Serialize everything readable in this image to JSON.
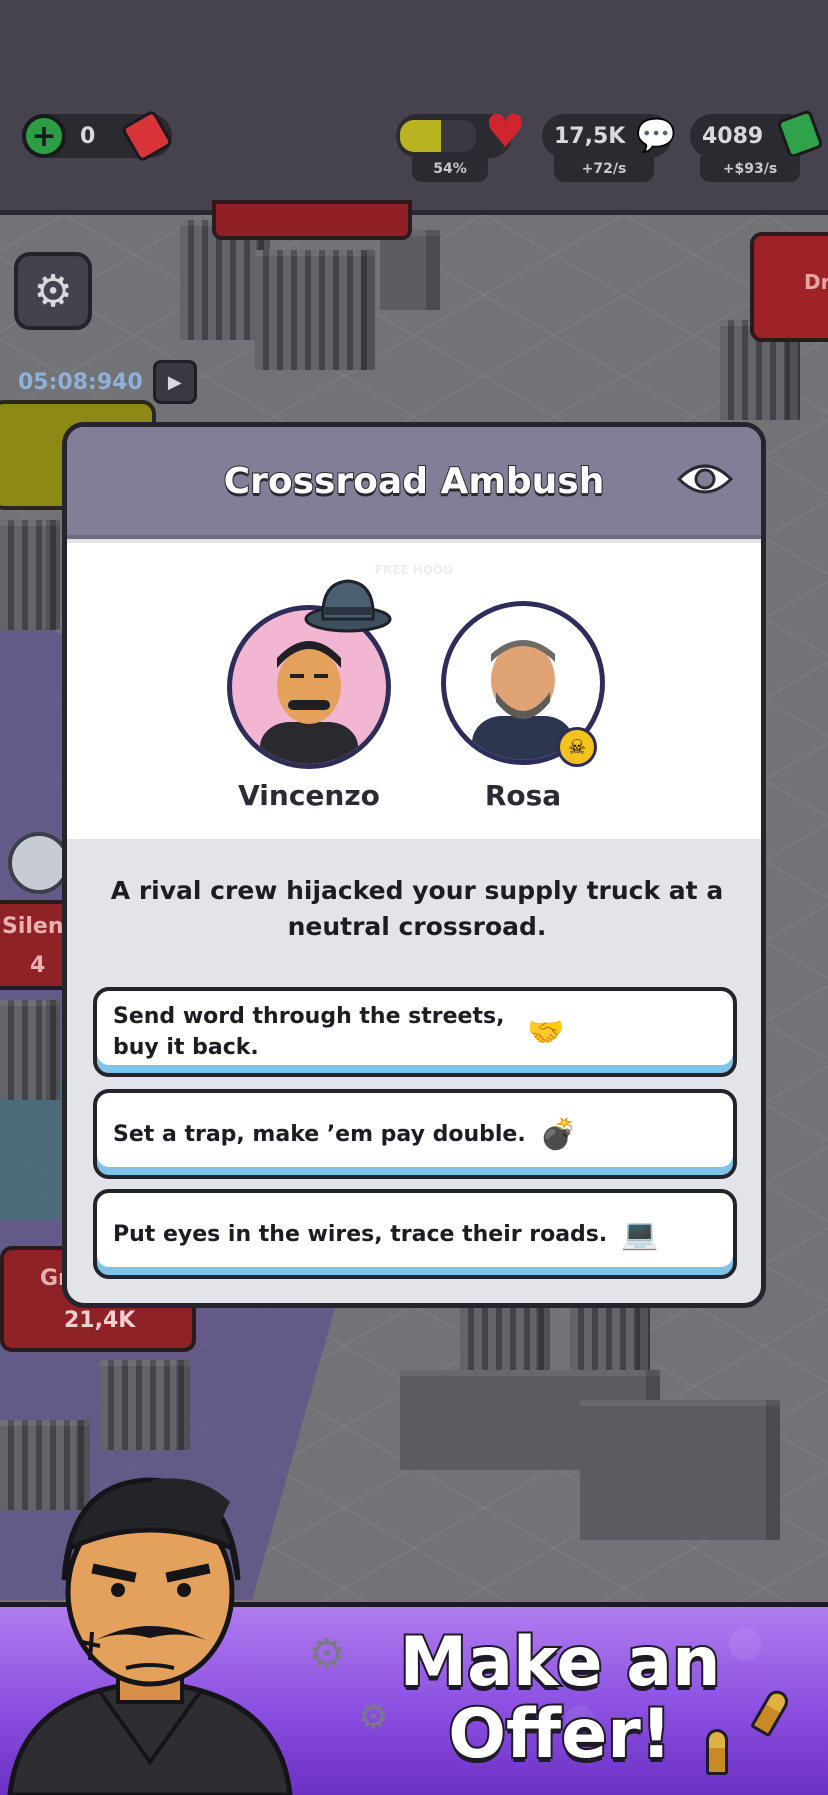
{
  "hud": {
    "gems_value": "0",
    "health_percent": 54,
    "health_label": "54%",
    "influence_value": "17,5K",
    "influence_rate": "+72/s",
    "cash_value": "4089",
    "cash_rate": "+$93/s"
  },
  "map": {
    "timer": "05:08:940",
    "right_label": "Dr",
    "silence_label": "Silenc",
    "silence_count": "4",
    "gr_label": "Gr",
    "gr_count": "21,4K"
  },
  "modal": {
    "title": "Crossroad Ambush",
    "faint_label": "FREE HOOD",
    "characters": [
      {
        "name": "Vincenzo"
      },
      {
        "name": "Rosa"
      }
    ],
    "story": "A rival crew hijacked your supply truck at a neutral crossroad.",
    "choices": [
      {
        "label": "Send word through the streets, buy it back.",
        "icon": "handshake-icon"
      },
      {
        "label": "Set a trap, make ’em pay double.",
        "icon": "bomb-icon"
      },
      {
        "label": "Put eyes in the wires, trace their roads.",
        "icon": "hacker-icon"
      }
    ]
  },
  "banner": {
    "line1": "Make an",
    "line2": "Offer!"
  },
  "colors": {
    "hud_bg": "#46434f",
    "modal_header": "#837e97",
    "choice_accent": "#7fc3e8",
    "banner_purple": "#8a4fe0",
    "health_fill": "#b9b221"
  }
}
